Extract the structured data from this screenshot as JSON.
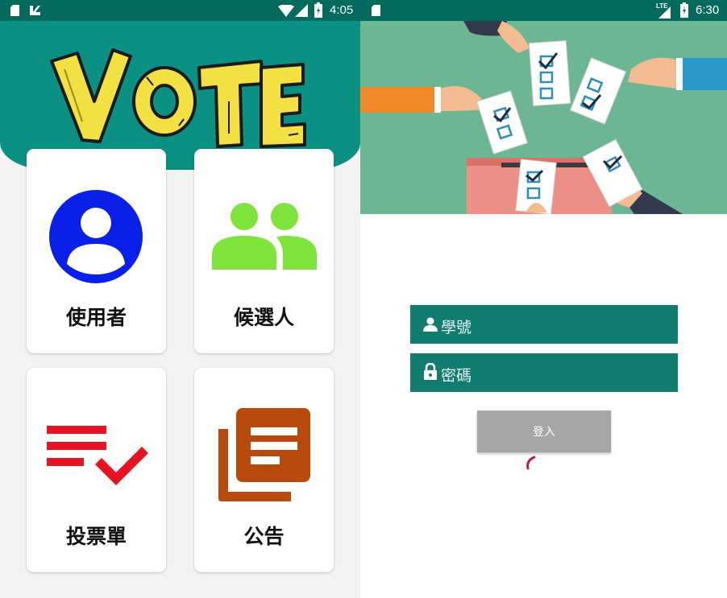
{
  "left_screen": {
    "status_bar": {
      "time": "4:05",
      "icons": [
        "sd-card-icon",
        "notification-icon",
        "wifi-icon",
        "signal-icon",
        "battery-icon"
      ]
    },
    "logo_text": "VOTE",
    "cards": [
      {
        "label": "使用者",
        "icon": "user-icon",
        "color": "#0a20e8"
      },
      {
        "label": "候選人",
        "icon": "group-icon",
        "color": "#7ee33a"
      },
      {
        "label": "投票單",
        "icon": "checklist-icon",
        "color": "#e81324"
      },
      {
        "label": "公告",
        "icon": "announcement-icon",
        "color": "#b74a0c"
      }
    ]
  },
  "right_screen": {
    "status_bar": {
      "time": "6:30",
      "network": "LTE",
      "icons": [
        "sd-card-icon",
        "signal-icon",
        "battery-icon"
      ]
    },
    "hero_image": "voting-illustration",
    "student_id_field": {
      "placeholder": "學號",
      "icon": "person-icon"
    },
    "password_field": {
      "placeholder": "密碼",
      "icon": "lock-icon"
    },
    "login_label": "登入",
    "loading": "spinner"
  },
  "colors": {
    "primary": "#0b9184",
    "primary_dark": "#046a5e",
    "field": "#117d70",
    "button": "#a6a6a6",
    "spinner": "#c2185b"
  }
}
